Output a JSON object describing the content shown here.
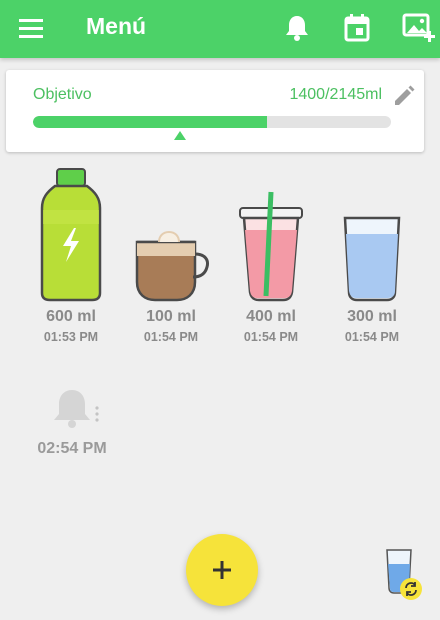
{
  "app_bar": {
    "title": "Menú",
    "icons": [
      "menu-icon",
      "bell-icon",
      "calendar-icon",
      "add-image-icon"
    ]
  },
  "goal": {
    "label": "Objetivo",
    "value_text": "1400/2145ml",
    "progress_fraction": 0.653,
    "edit_icon": "pencil-icon"
  },
  "drinks": [
    {
      "icon": "sports-drink-bottle-icon",
      "amount": "600 ml",
      "time": "01:53 PM"
    },
    {
      "icon": "cappuccino-cup-icon",
      "amount": "100 ml",
      "time": "01:54 PM"
    },
    {
      "icon": "iced-drink-cup-icon",
      "amount": "400 ml",
      "time": "01:54 PM"
    },
    {
      "icon": "water-glass-icon",
      "amount": "300 ml",
      "time": "01:54 PM"
    }
  ],
  "reminder": {
    "icon": "bell-icon",
    "time": "02:54 PM"
  },
  "fab": {
    "icon": "plus-icon"
  },
  "switch_cup": {
    "icon": "glass-refresh-icon"
  },
  "colors": {
    "primary": "#4cd268",
    "accent": "#f6e33a",
    "text_muted": "#8a8a8a",
    "background": "#efefef"
  }
}
